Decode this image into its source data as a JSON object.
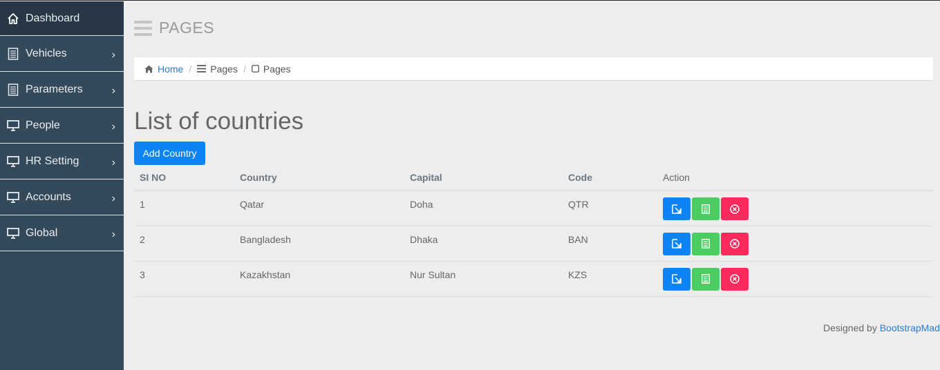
{
  "sidebar": {
    "items": [
      {
        "label": "Dashboard",
        "icon": "home-icon"
      },
      {
        "label": "Vehicles",
        "icon": "document-icon"
      },
      {
        "label": "Parameters",
        "icon": "document-icon"
      },
      {
        "label": "People",
        "icon": "monitor-icon"
      },
      {
        "label": "HR Setting",
        "icon": "monitor-icon"
      },
      {
        "label": "Accounts",
        "icon": "monitor-icon"
      },
      {
        "label": "Global",
        "icon": "monitor-icon"
      }
    ],
    "chevron": "›"
  },
  "header": {
    "title": "PAGES"
  },
  "breadcrumb": {
    "home": "Home",
    "pages1": "Pages",
    "pages2": "Pages",
    "separator": "/"
  },
  "main": {
    "title": "List of countries",
    "add_button": "Add Country"
  },
  "table": {
    "headers": {
      "sino": "SI NO",
      "country": "Country",
      "capital": "Capital",
      "code": "Code",
      "action": "Action"
    },
    "rows": [
      {
        "sino": "1",
        "country": "Qatar",
        "capital": "Doha",
        "code": "QTR"
      },
      {
        "sino": "2",
        "country": "Bangladesh",
        "capital": "Dhaka",
        "code": "BAN"
      },
      {
        "sino": "3",
        "country": "Kazakhstan",
        "capital": "Nur Sultan",
        "code": "KZS"
      }
    ]
  },
  "footer": {
    "text": "Designed by ",
    "link": "BootstrapMade"
  },
  "colors": {
    "sidebar": "#34495a",
    "primary": "#0d84f4",
    "success": "#4ccd62",
    "danger": "#fb2a5c"
  }
}
